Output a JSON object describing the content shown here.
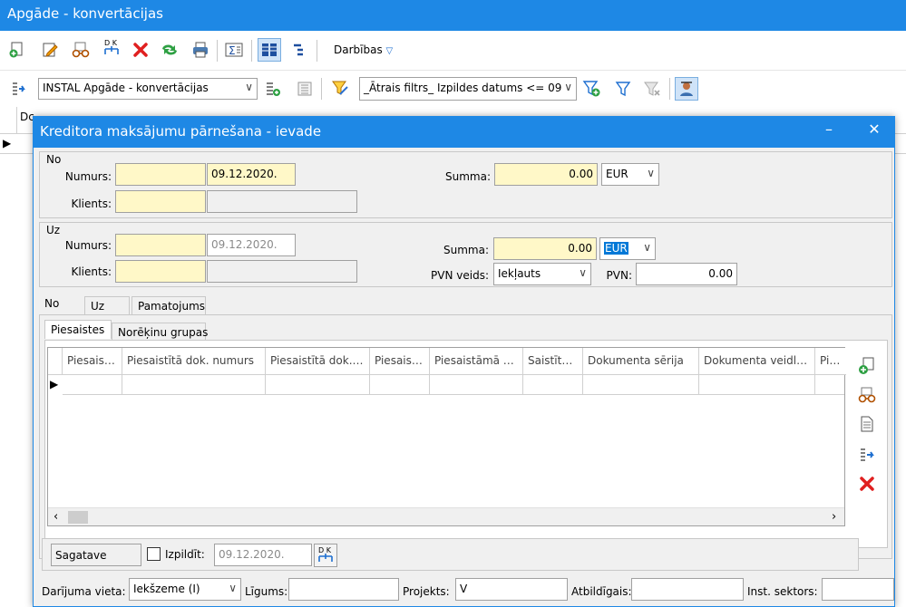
{
  "window": {
    "title": "Apgāde - konvertācijas"
  },
  "toolbar": {
    "actions_label": "Darbības",
    "dk_label": "D K",
    "view_combo": "INSTAL Apgāde - konvertācijas",
    "filter_combo": "_Ātrais filtrs_ Izpildes datums <= 09"
  },
  "main_grid": {
    "first_col_header": "Dc"
  },
  "dialog": {
    "title": "Kreditora maksājumu pārnešana - ievade",
    "minimize_symbol": "–",
    "close_symbol": "✕",
    "from": {
      "group_label": "No",
      "number_label": "Numurs:",
      "number_value": "",
      "date_value": "09.12.2020.",
      "client_label": "Klients:",
      "client_value": "",
      "client_name": "",
      "sum_label": "Summa:",
      "sum_value": "0.00",
      "currency": "EUR"
    },
    "to": {
      "group_label": "Uz",
      "number_label": "Numurs:",
      "number_value": "",
      "date_value": "09.12.2020.",
      "client_label": "Klients:",
      "client_value": "",
      "client_name": "",
      "sum_label": "Summa:",
      "sum_value": "0.00",
      "currency": "EUR",
      "vat_type_label": "PVN veids:",
      "vat_type_value": "Iekļauts",
      "vat_label": "PVN:",
      "vat_value": "0.00"
    },
    "tabs": [
      "No",
      "Uz",
      "Pamatojums"
    ],
    "subtabs": [
      "Piesaistes",
      "Norēķinu grupas"
    ],
    "grid_columns": [
      "Piesaist...",
      "Piesaistītā dok. numurs",
      "Piesaistītā dok. ...",
      "Piesaist...",
      "Piesaistāmā s...",
      "Saistītā...",
      "Dokumenta sērija",
      "Dokumenta veidla...",
      "Piesa"
    ],
    "status": {
      "state": "Sagatave",
      "executed_label": "Izpildīt:",
      "executed_date": "09.12.2020.",
      "dk_label": "D K"
    },
    "bottom": {
      "place_label": "Darījuma vieta:",
      "place_value": "Iekšzeme (I)",
      "contract_label": "Līgums:",
      "contract_value": "",
      "project_label": "Projekts:",
      "project_value": "V",
      "responsible_label": "Atbildīgais:",
      "responsible_value": "",
      "sector_label": "Inst. sektors:",
      "sector_value": ""
    }
  },
  "colors": {
    "titlebar": "#1e88e5",
    "required_field": "#fff8c8",
    "selection": "#0078d7"
  }
}
